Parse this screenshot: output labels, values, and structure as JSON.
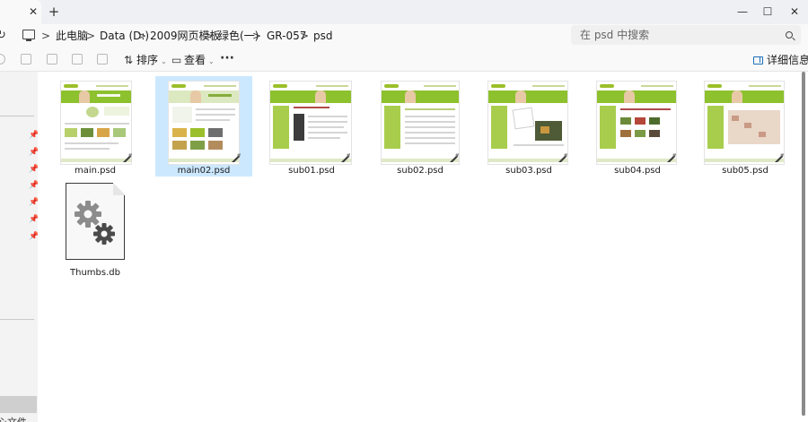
{
  "window": {
    "tab_close": "✕",
    "new_tab": "+",
    "minimize": "—",
    "maximize": "☐",
    "close": "✕"
  },
  "address": {
    "refresh_glyph": "↻",
    "sep": ">",
    "crumbs": [
      "此电脑",
      "Data (D:)",
      "2009网页模板",
      "绿色(一)",
      "GR-057",
      "psd"
    ]
  },
  "search": {
    "placeholder": "在 psd 中搜索"
  },
  "toolbar": {
    "sort_label": "排序",
    "view_label": "查看",
    "more_glyph": "···",
    "details_label": "详细信息"
  },
  "nav": {
    "cut_text": "心文件"
  },
  "files": [
    {
      "name": "main.psd",
      "selected": false,
      "kind": "psd"
    },
    {
      "name": "main02.psd",
      "selected": true,
      "kind": "psd"
    },
    {
      "name": "sub01.psd",
      "selected": false,
      "kind": "psd"
    },
    {
      "name": "sub02.psd",
      "selected": false,
      "kind": "psd"
    },
    {
      "name": "sub03.psd",
      "selected": false,
      "kind": "psd"
    },
    {
      "name": "sub04.psd",
      "selected": false,
      "kind": "psd"
    },
    {
      "name": "sub05.psd",
      "selected": false,
      "kind": "psd"
    },
    {
      "name": "Thumbs.db",
      "selected": false,
      "kind": "system"
    }
  ],
  "colors": {
    "selection": "#cce8ff",
    "accent": "#1d6fb8",
    "thumbnail_green": "#8dc12d"
  },
  "icons": {
    "psd_badge": "gimp-brush-icon",
    "system_file": "settings-gear-icon"
  }
}
